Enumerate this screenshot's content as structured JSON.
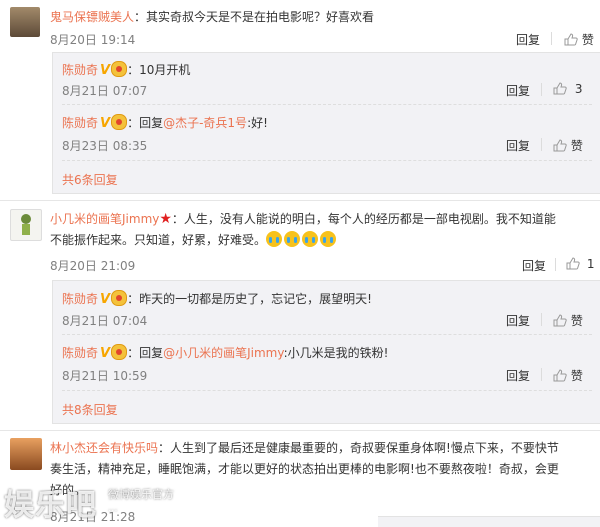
{
  "comments": [
    {
      "author": "鬼马保镖贼美人",
      "text": "：其实奇叔今天是不是在拍电影呢？好喜欢看",
      "time": "8月20日 19:14",
      "reply_label": "回复",
      "like_label": "赞",
      "replies": [
        {
          "author": "陈勋奇",
          "verified": true,
          "text": "：10月开机",
          "time": "8月21日 07:07",
          "reply_label": "回复",
          "like_label": "3"
        },
        {
          "author": "陈勋奇",
          "verified": true,
          "text_prefix": "：回复",
          "mention": "@杰子-奇兵1号",
          "text_suffix": ":好!",
          "time": "8月23日 08:35",
          "reply_label": "回复",
          "like_label": "赞"
        }
      ],
      "more": "共6条回复"
    },
    {
      "author": "小几米的画笔Jimmy",
      "text": "：人生，没有人能说的明白，每个人的经历都是一部电视剧。我不知道能",
      "text2": "不能振作起来。只知道，好累，好难受。",
      "time": "8月20日 21:09",
      "reply_label": "回复",
      "like_label": "1",
      "replies": [
        {
          "author": "陈勋奇",
          "verified": true,
          "text": "：昨天的一切都是历史了，忘记它，展望明天!",
          "time": "8月21日 07:04",
          "reply_label": "回复",
          "like_label": "赞"
        },
        {
          "author": "陈勋奇",
          "verified": true,
          "text_prefix": "：回复",
          "mention": "@小几米的画笔Jimmy",
          "text_suffix": ":小几米是我的铁粉!",
          "time": "8月21日 10:59",
          "reply_label": "回复",
          "like_label": "赞"
        }
      ],
      "more": "共8条回复"
    },
    {
      "author": "林小杰还会有快乐吗",
      "text": "：人生到了最后还是健康最重要的，奇叔要保重身体啊!慢点下来，不要快节",
      "text2": "奏生活，精神充足，睡眠饱满，才能以更好的状态拍出更棒的电影啊!也不要熬夜啦！奇叔，会更",
      "text3": "好的。",
      "time": "8月21日 21:28"
    }
  ],
  "watermark": {
    "logo": "娱乐吧",
    "sub": "微博娱乐官方",
    "url": "..."
  },
  "colors": {
    "name": "#eb7350",
    "panel": "#f2f2f5"
  }
}
